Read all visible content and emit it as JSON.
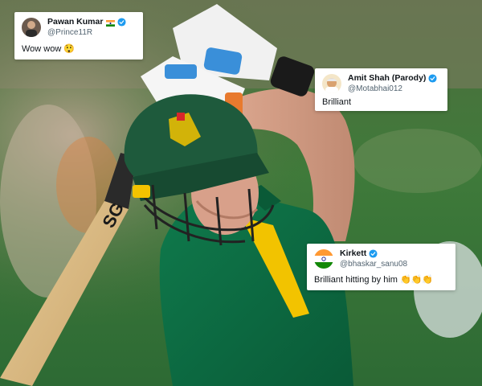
{
  "image": {
    "description_icon": "cricket-batsman-photo"
  },
  "tweets": [
    {
      "name": "Pawan Kumar",
      "handle": "@Prince11R",
      "text": "Wow wow 😲",
      "flag_icon": "india-flag-icon",
      "verified_icon": "verified-badge-icon"
    },
    {
      "name": "Amit Shah (Parody)",
      "handle": "@Motabhai012",
      "text": "Brilliant",
      "verified_icon": "verified-badge-icon"
    },
    {
      "name": "Kirkett",
      "handle": "@bhaskar_sanu08",
      "text": "Brilliant hitting by him 👏👏👏",
      "verified_icon": "verified-badge-icon"
    }
  ],
  "colors": {
    "verified_blue": "#1d9bf0",
    "handle_gray": "#536471",
    "tweet_bg": "#ffffff",
    "jersey_green": "#0e6b44",
    "helmet_green": "#1e5a3c",
    "jersey_gold": "#f2c300"
  }
}
